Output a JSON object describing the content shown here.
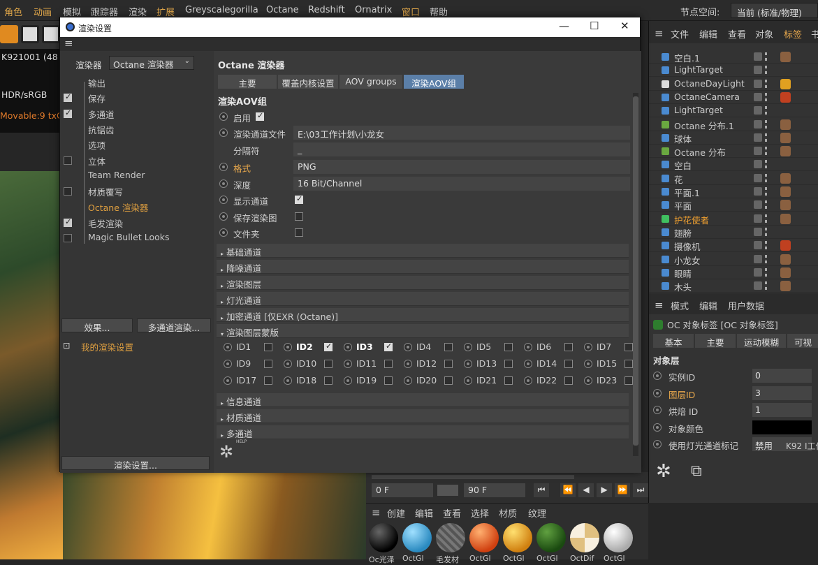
{
  "menubar": {
    "items": [
      "角色",
      "动画",
      "模拟",
      "跟踪器",
      "渲染",
      "扩展",
      "Greyscalegorilla",
      "Octane",
      "Redshift",
      "Ornatrix",
      "窗口",
      "帮助"
    ],
    "node_space_label": "节点空间:",
    "node_space_value": "当前 (标准/物理)"
  },
  "viewport": {
    "line1": "K921001   (48",
    "line2": "HDR/sRGB",
    "line3": "Movable:9 txC"
  },
  "dialog": {
    "title": "渲染设置",
    "window_buttons": [
      "—",
      "☐",
      "✕"
    ],
    "renderer_label": "渲染器",
    "renderer_value": "Octane 渲染器",
    "tree": [
      {
        "label": "输出",
        "checkbox": null
      },
      {
        "label": "保存",
        "checkbox": true
      },
      {
        "label": "多通道",
        "checkbox": true
      },
      {
        "label": "抗锯齿",
        "checkbox": null
      },
      {
        "label": "选项",
        "checkbox": null
      },
      {
        "label": "立体",
        "checkbox": false
      },
      {
        "label": "Team Render",
        "checkbox": null
      },
      {
        "label": "材质覆写",
        "checkbox": false
      },
      {
        "label": "Octane 渲染器",
        "checkbox": null,
        "selected": true
      },
      {
        "label": "毛发渲染",
        "checkbox": true
      },
      {
        "label": "Magic Bullet Looks",
        "checkbox": false
      }
    ],
    "effects_button": "效果...",
    "multipass_button": "多通道渲染...",
    "my_settings": "我的渲染设置",
    "render_settings_button": "渲染设置...",
    "section_title": "Octane 渲染器",
    "tabs": [
      "主要",
      "覆盖内核设置",
      "AOV groups",
      "渲染AOV组"
    ],
    "active_tab": 3,
    "group_title": "渲染AOV组",
    "params": {
      "enable_label": "启用",
      "file_label": "渲染通道文件",
      "file_value": "E:\\03工作计划\\小龙女",
      "sep_label": "分隔符",
      "sep_value": "_",
      "format_label": "格式",
      "format_value": "PNG",
      "depth_label": "深度",
      "depth_value": "16 Bit/Channel",
      "show_label": "显示通道",
      "save_label": "保存渲染图",
      "folder_label": "文件夹"
    },
    "groups_top": [
      "基础通道",
      "降噪通道",
      "渲染图层",
      "灯光通道",
      "加密通道 [仅EXR (Octane)]",
      "渲染图层蒙版"
    ],
    "ids": [
      {
        "label": "ID1",
        "checked": false
      },
      {
        "label": "ID2",
        "checked": true
      },
      {
        "label": "ID3",
        "checked": true
      },
      {
        "label": "ID4",
        "checked": false
      },
      {
        "label": "ID5",
        "checked": false
      },
      {
        "label": "ID6",
        "checked": false
      },
      {
        "label": "ID7",
        "checked": false
      },
      {
        "label": "ID9",
        "checked": false
      },
      {
        "label": "ID10",
        "checked": false
      },
      {
        "label": "ID11",
        "checked": false
      },
      {
        "label": "ID12",
        "checked": false
      },
      {
        "label": "ID13",
        "checked": false
      },
      {
        "label": "ID14",
        "checked": false
      },
      {
        "label": "ID15",
        "checked": false
      },
      {
        "label": "ID17",
        "checked": false
      },
      {
        "label": "ID18",
        "checked": false
      },
      {
        "label": "ID19",
        "checked": false
      },
      {
        "label": "ID20",
        "checked": false
      },
      {
        "label": "ID21",
        "checked": false
      },
      {
        "label": "ID22",
        "checked": false
      },
      {
        "label": "ID23",
        "checked": false
      }
    ],
    "groups_bottom": [
      "信息通道",
      "材质通道",
      "多通道"
    ],
    "help_label": "HELP"
  },
  "object_manager": {
    "header": [
      "文件",
      "编辑",
      "查看",
      "对象",
      "标签",
      "书"
    ],
    "rows": [
      {
        "name": "空白.1",
        "type": "null"
      },
      {
        "name": "LightTarget",
        "type": "null"
      },
      {
        "name": "OctaneDayLight",
        "type": "light"
      },
      {
        "name": "OctaneCamera",
        "type": "camera"
      },
      {
        "name": "LightTarget",
        "type": "null"
      },
      {
        "name": "Octane 分布.1",
        "type": "scatter"
      },
      {
        "name": "球体",
        "type": "sphere"
      },
      {
        "name": "Octane 分布",
        "type": "scatter"
      },
      {
        "name": "空白",
        "type": "null"
      },
      {
        "name": "花",
        "type": "null"
      },
      {
        "name": "平面.1",
        "type": "plane"
      },
      {
        "name": "平面",
        "type": "plane"
      },
      {
        "name": "护花使者",
        "type": "special",
        "highlight": true
      },
      {
        "name": "翅膀",
        "type": "null"
      },
      {
        "name": "摄像机",
        "type": "camera"
      },
      {
        "name": "小龙女",
        "type": "joint"
      },
      {
        "name": "眼睛",
        "type": "joint"
      },
      {
        "name": "木头",
        "type": "joint"
      }
    ]
  },
  "attributes": {
    "header": [
      "模式",
      "编辑",
      "用户数据"
    ],
    "title": "OC 对象标签 [OC 对象标签]",
    "tabs": [
      "基本",
      "主要",
      "运动模糊",
      "可视"
    ],
    "section": "对象层",
    "rows": [
      {
        "label": "实例ID",
        "value": "0"
      },
      {
        "label": "图层ID",
        "value": "3",
        "orange": true
      },
      {
        "label": "烘焙 ID",
        "value": "1"
      },
      {
        "label": "对象颜色",
        "value": ""
      },
      {
        "label": "使用灯光通道标记",
        "value": "禁用"
      }
    ],
    "extra": "K92 I工作"
  },
  "timeline": {
    "start": "0 F",
    "end": "90 F"
  },
  "materials": {
    "header": [
      "创建",
      "编辑",
      "查看",
      "选择",
      "材质",
      "纹理"
    ],
    "items": [
      "Oc光泽",
      "OctGl",
      "毛发材",
      "OctGl",
      "OctGl",
      "OctGl",
      "OctDif",
      "OctGl"
    ]
  },
  "colors": {
    "accent": "#e8a84c",
    "active_tab": "#5b7fa8"
  }
}
